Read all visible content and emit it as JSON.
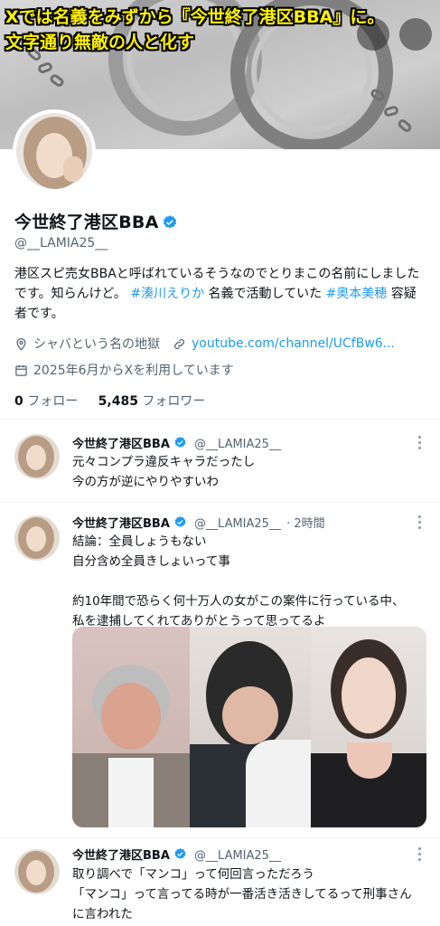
{
  "banner": {
    "headline_line1": "Xでは名義をみずから『今世終了港区BBA』に。",
    "headline_line2": "文字通り無敵の人と化す",
    "headline_color": "#fff200"
  },
  "profile": {
    "name": "今世終了港区BBA",
    "handle": "@__LAMIA25__",
    "bio_part1": "港区スピ売女BBAと呼ばれているそうなのでとりまこの名前にしましたです。知らんけど。",
    "bio_hashtag1": "#湊川えりか",
    "bio_part2": " 名義で活動していた ",
    "bio_hashtag2": "#奥本美穂",
    "bio_part3": " 容疑者です。",
    "location": "シャバという名の地獄",
    "website": "youtube.com/channel/UCfBw6...",
    "joined": "2025年6月からXを利用しています",
    "following_count": "0",
    "following_label": "フォロー",
    "followers_count": "5,485",
    "followers_label": "フォロワー",
    "icons": [
      "location-icon",
      "link-icon",
      "calendar-icon",
      "verified-badge-icon"
    ],
    "accent_color": "#1d9bf0"
  },
  "tweets": [
    {
      "name": "今世終了港区BBA",
      "handle": "@__LAMIA25__",
      "time": "",
      "lines": [
        "元々コンプラ違反キャラだったし",
        "今の方が逆にやりやすいわ"
      ]
    },
    {
      "name": "今世終了港区BBA",
      "handle": "@__LAMIA25__",
      "time": "· 2時間",
      "lines": [
        "結論：全員しょうもない",
        "自分含め全員きしょいって事",
        "",
        "約10年間で恐らく何十万人の女がこの案件に行っている中、",
        "私を逮捕してくれてありがとうって思ってるよ"
      ]
    },
    {
      "name": "今世終了港区BBA",
      "handle": "@__LAMIA25__",
      "time": "",
      "lines": [
        "取り調べで「マンコ」って何回言っただろう",
        "「マンコ」って言ってる時が一番活き活きしてるって刑事さん",
        "に言われた"
      ]
    }
  ]
}
